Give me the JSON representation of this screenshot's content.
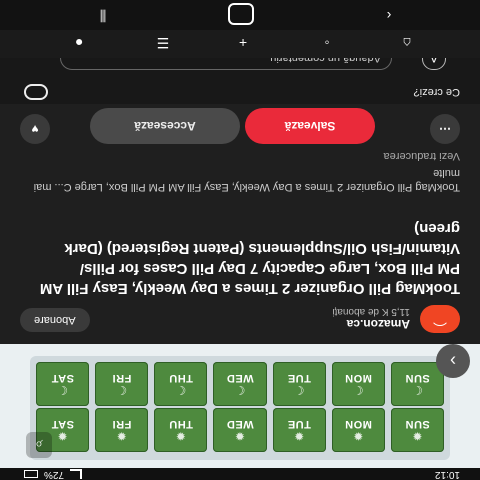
{
  "status": {
    "time": "10:12",
    "battery_percent": "72%"
  },
  "product": {
    "top_days": [
      "SUN",
      "MON",
      "TUE",
      "WED",
      "THU",
      "FRI",
      "SAT"
    ],
    "bottom_days": [
      "SUN",
      "MON",
      "TUE",
      "WED",
      "THU",
      "FRI",
      "SAT"
    ],
    "top_symbol": "✹",
    "bottom_symbol": "☾"
  },
  "channel": {
    "name": "Amazon.ca",
    "subs": "11,5 K de abonați",
    "subscribe_label": "Abonare"
  },
  "title": "TookMag Pill Organizer 2 Times a Day Weekly, Easy Fill AM PM Pill Box, Large Capacity 7 Day Pill Cases for Pills/ Vitamin/Fish Oil/Supplements (Patent Registered) (Dark green)",
  "description": "TookMag Pill Organizer 2 Times a Day Weekly, Easy Fill AM PM Pill Box, Large C... mai multe",
  "translate": "Vezi traducerea",
  "actions": {
    "save_label": "Salvează",
    "access_label": "Accesează"
  },
  "comments": {
    "prompt": "Ce crezi?",
    "placeholder": "Adaugă un comentariu",
    "avatar_letter": "A"
  },
  "nav": {
    "home_icon": "home-icon",
    "shorts_icon": "shorts-icon",
    "create_icon": "plus-icon",
    "subs_icon": "subscriptions-icon",
    "you_icon": "profile-icon"
  }
}
